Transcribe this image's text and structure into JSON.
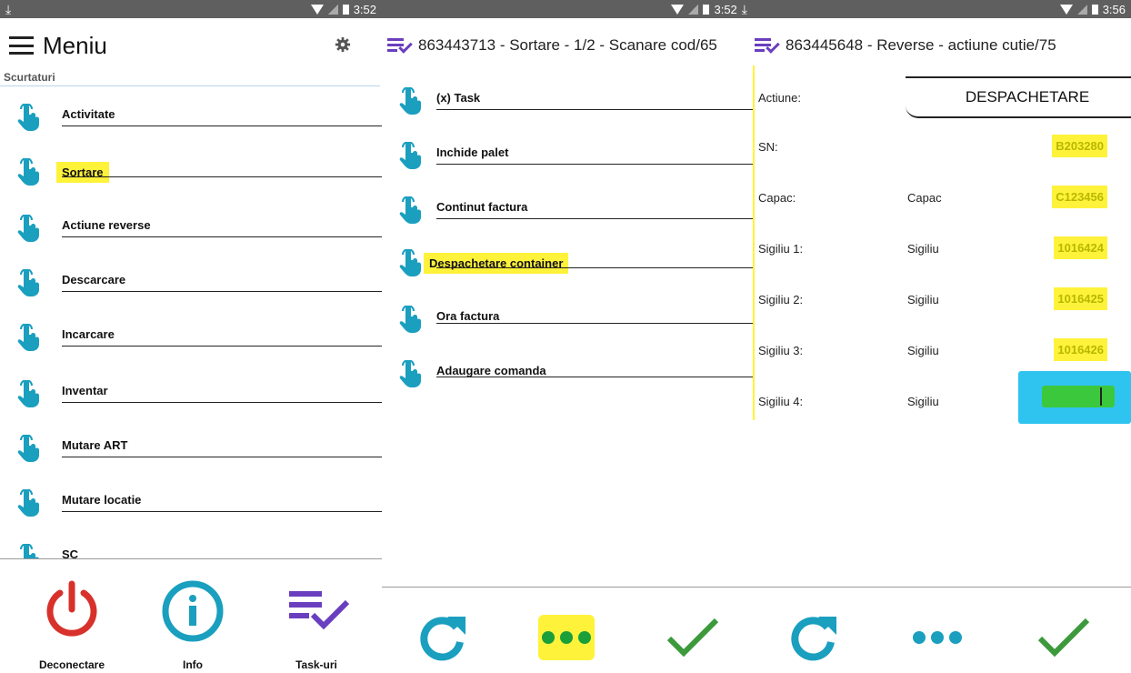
{
  "status": {
    "time1": "3:52",
    "time2": "3:52",
    "time3": "3:56"
  },
  "panel1": {
    "title": "Meniu",
    "shortcuts_label": "Scurtaturi",
    "items": [
      {
        "label": "Activitate"
      },
      {
        "label": "Sortare"
      },
      {
        "label": "Actiune reverse"
      },
      {
        "label": "Descarcare"
      },
      {
        "label": "Incarcare"
      },
      {
        "label": "Inventar"
      },
      {
        "label": "Mutare ART"
      },
      {
        "label": "Mutare locatie"
      },
      {
        "label": "SC"
      }
    ],
    "bottom": {
      "logout": "Deconectare",
      "info": "Info",
      "tasks": "Task-uri"
    }
  },
  "panel2": {
    "title": "863443713 - Sortare - 1/2 - Scanare cod/65",
    "items": [
      {
        "label": "(x) Task"
      },
      {
        "label": "Inchide palet"
      },
      {
        "label": "Continut factura"
      },
      {
        "label": "Despachetare container"
      },
      {
        "label": "Ora factura"
      },
      {
        "label": "Adaugare comanda"
      }
    ]
  },
  "panel3": {
    "title": "863445648 - Reverse - actiune cutie/75",
    "action_label": "Actiune:",
    "action_value": "DESPACHETARE",
    "rows": [
      {
        "key": "SN:",
        "placeholder": "",
        "value": "B203280"
      },
      {
        "key": "Capac:",
        "placeholder": "Capac",
        "value": "C123456"
      },
      {
        "key": "Sigiliu 1:",
        "placeholder": "Sigiliu",
        "value": "1016424"
      },
      {
        "key": "Sigiliu 2:",
        "placeholder": "Sigiliu",
        "value": "1016425"
      },
      {
        "key": "Sigiliu 3:",
        "placeholder": "Sigiliu",
        "value": "1016426"
      },
      {
        "key": "Sigiliu 4:",
        "placeholder": "Sigiliu",
        "value": ""
      }
    ]
  },
  "colors": {
    "accent_blue": "#1a9fbf",
    "task_purple": "#6a3fbf",
    "power_red": "#d8312b",
    "check_green": "#3c9a3c",
    "highlight_yellow": "#fff23a",
    "active_field": "#2fc4f0"
  }
}
